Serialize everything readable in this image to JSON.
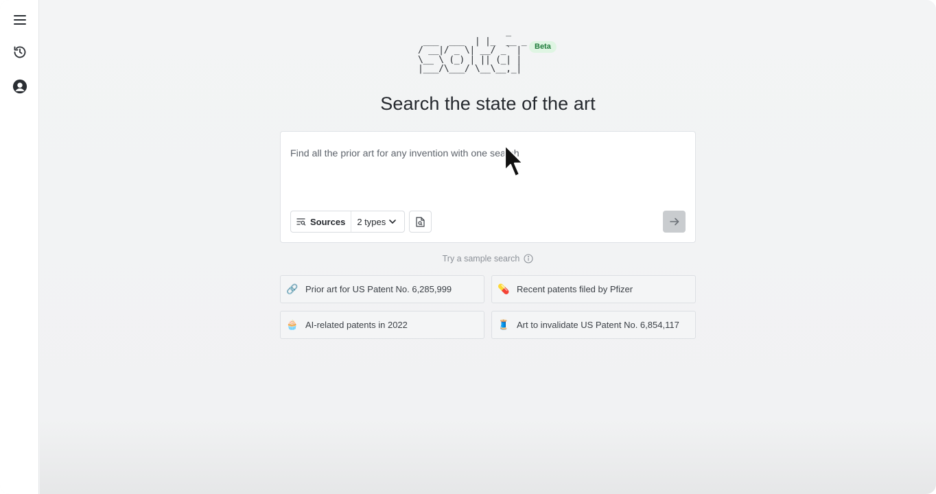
{
  "sidebar": {
    "items": [
      {
        "icon": "menu-icon"
      },
      {
        "icon": "history-icon"
      },
      {
        "icon": "profile-icon"
      }
    ]
  },
  "logo": {
    "ascii": "                 _\n ___  ___  | |_  __ _\n/ __|/ _ \\| __/ _` |\n\\__ \\ (_) | || (_| |\n|___/\\___/ \\__\\__,_|",
    "badge": "Beta"
  },
  "headline": "Search the state of the art",
  "search": {
    "placeholder": "Find all the prior art for any invention with one search",
    "sources_label": "Sources",
    "types_label": "2 types"
  },
  "samples": {
    "hint": "Try a sample search",
    "items": [
      {
        "label": "Prior art for US Patent No. 6,285,999",
        "icon": "link-icon"
      },
      {
        "label": "Recent patents filed by Pfizer",
        "icon": "pill-icon"
      },
      {
        "label": "AI-related patents in 2022",
        "icon": "cupcake-icon"
      },
      {
        "label": "Art to invalidate US Patent No. 6,854,117",
        "icon": "thread-spool-icon"
      }
    ]
  },
  "colors": {
    "accent_badge": "#dff5e3",
    "submit_disabled": "#c9cccf"
  }
}
